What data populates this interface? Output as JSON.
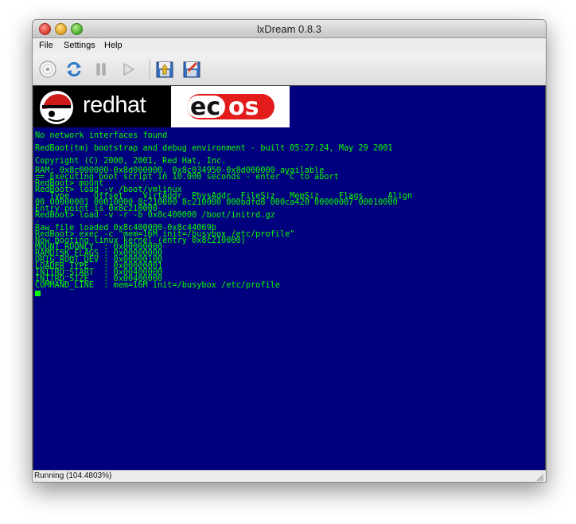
{
  "window": {
    "title": "lxDream 0.8.3"
  },
  "menubar": {
    "items": [
      "File",
      "Settings",
      "Help"
    ]
  },
  "toolbar": {
    "buttons": [
      "disc-icon",
      "reset-icon",
      "pause-icon",
      "run-icon",
      "load-state-icon",
      "save-state-icon"
    ]
  },
  "screen": {
    "logos": {
      "redhat": "redhat",
      "ecos": "ecos"
    },
    "lines": [
      "No network interfaces found",
      "RedBoot(tm) bootstrap and debug environment - built 05:27:24, May 29 2001",
      "Copyright (C) 2000, 2001, Red Hat, Inc.",
      "RAM: 0x8c000000-0x8d000000, 0x8c034950-0x8d000000 available",
      "== Executing boot script in 10.000 seconds - enter ^C to abort",
      "RedBoot> mount",
      "RedBoot> load -v /boot/vmlinux",
      "   Type     Offset    VirtAddr  PhysAddr  FileSiz   MemSiz    Flags     Align",
      "00 00000001 00010000 8c210000 8c210000 000bdfd8 000ca420 00000007 00010000",
      "Entry point is 0x8c210000",
      "RedBoot> load -v -r -b 0x8c400000 /boot/initrd.gz",
      "-",
      "Raw file loaded 0x8c400000-0x8c44069b",
      "RedBoot> exec -c \"mem=16M init=/busybox /etc/profile\"",
      "Now booting linux kernel (entry 0x8c210000)",
      "MOUNT_RDONLY  : 0x00000000",
      "RAMDISK_FLAGS : 0x00000000",
      "ORIG_ROOT_DEV : 0x00000100",
      "LOADER_TYPE   : 0x00000001",
      "INITRD_START  : 0x00400000",
      "INITRD_SIZE   : 0x00400000",
      "COMMAND_LINE  : mem=16M init=/busybox /etc/profile"
    ],
    "colors": {
      "background": "#00007f",
      "text": "#00ff00"
    }
  },
  "statusbar": {
    "text": "Running (104.4803%)"
  }
}
